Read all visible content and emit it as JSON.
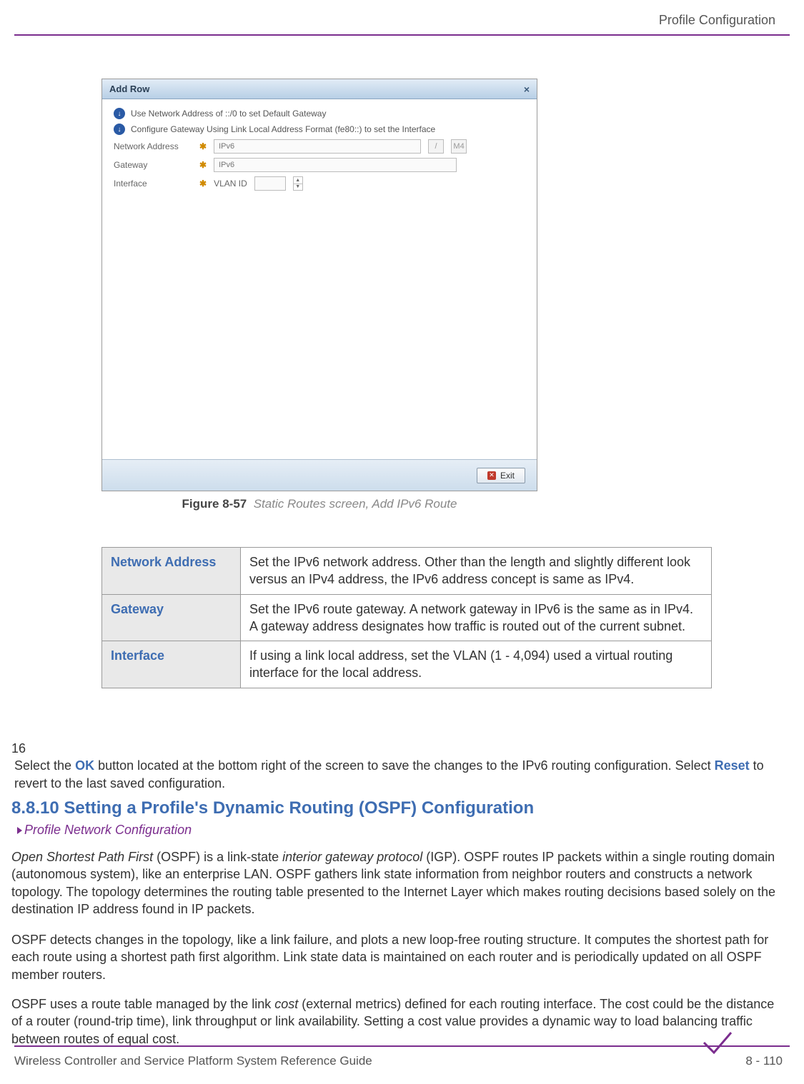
{
  "header": {
    "section": "Profile Configuration"
  },
  "dialog": {
    "title": "Add Row",
    "close": "×",
    "info1": "Use Network Address of ::/0 to set Default Gateway",
    "info2": "Configure Gateway Using Link Local Address Format (fe80::) to set the Interface",
    "labels": {
      "network_address": "Network Address",
      "gateway": "Gateway",
      "interface": "Interface",
      "vlan_id": "VLAN ID"
    },
    "placeholders": {
      "ipv6": "IPv6"
    },
    "suffix": "/",
    "mask": "M4",
    "exit": "Exit"
  },
  "figure": {
    "prefix": "Figure 8-57",
    "desc": "Static Routes screen, Add IPv6 Route"
  },
  "table": {
    "rows": [
      {
        "label": "Network Address",
        "desc": "Set the IPv6 network address. Other than the length and slightly different look versus an IPv4 address, the IPv6 address concept is same as IPv4."
      },
      {
        "label": "Gateway",
        "desc": "Set the IPv6 route gateway. A network gateway in IPv6 is the same as in IPv4. A gateway address designates how traffic is routed out of the current subnet."
      },
      {
        "label": "Interface",
        "desc": "If using a link local address, set the VLAN (1 - 4,094) used a virtual routing interface for the local address."
      }
    ]
  },
  "step": {
    "num": "16",
    "before_ok": "Select the ",
    "ok": "OK",
    "mid": " button located at the bottom right of the screen to save the changes to the IPv6 routing configuration. Select ",
    "reset": "Reset",
    "after": " to revert to the last saved configuration."
  },
  "section": {
    "heading": "8.8.10 Setting a Profile's Dynamic Routing (OSPF) Configuration",
    "breadcrumb": "Profile Network Configuration"
  },
  "paragraphs": {
    "p1_a": "Open Shortest Path First",
    "p1_b": " (OSPF) is a link-state ",
    "p1_c": "interior gateway protocol",
    "p1_d": " (IGP). OSPF routes IP packets within a single routing domain (autonomous system), like an enterprise LAN. OSPF gathers link state information from neighbor routers and constructs a network topology. The topology determines the routing table presented to the Internet Layer which makes routing decisions based solely on the destination IP address found in IP packets.",
    "p2": "OSPF detects changes in the topology, like a link failure, and plots a new loop-free routing structure. It computes the shortest path for each route using a shortest path first algorithm. Link state data is maintained on each router and is periodically updated on all OSPF member routers.",
    "p3_a": "OSPF uses a route table managed by the link ",
    "p3_b": "cost",
    "p3_c": " (external metrics) defined for each routing interface. The cost could be the distance of a router (round-trip time), link throughput or link availability. Setting a cost value provides a dynamic way to load balancing traffic between routes of equal cost."
  },
  "footer": {
    "text": "Wireless Controller and Service Platform System Reference Guide",
    "page": "8 - 110"
  }
}
